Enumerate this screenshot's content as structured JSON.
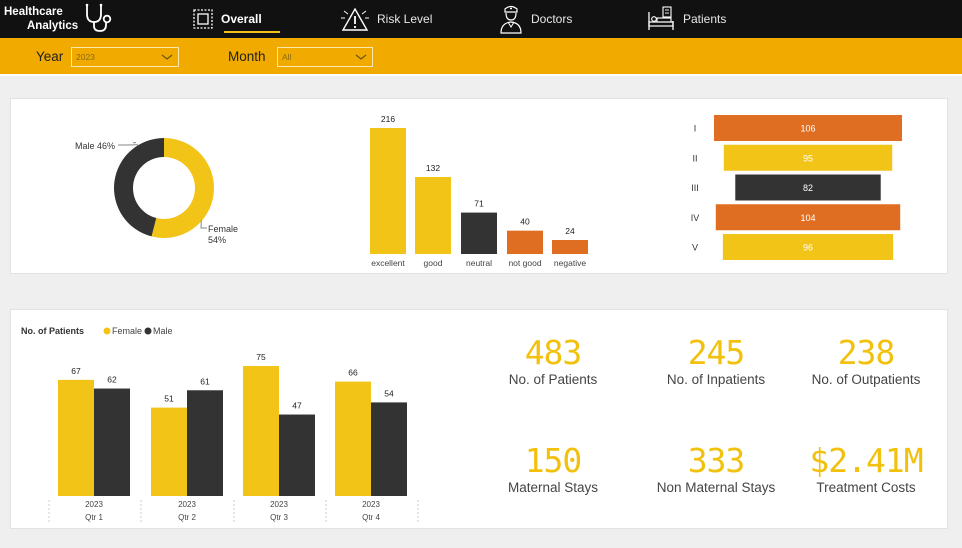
{
  "header": {
    "brand_line1": "Healthcare",
    "brand_line2": "Analytics",
    "nav": [
      {
        "label": "Overall",
        "icon": "dashboard-icon",
        "active": true
      },
      {
        "label": "Risk Level",
        "icon": "warning-icon",
        "active": false
      },
      {
        "label": "Doctors",
        "icon": "doctor-icon",
        "active": false
      },
      {
        "label": "Patients",
        "icon": "patient-bed-icon",
        "active": false
      }
    ]
  },
  "filters": {
    "year_label": "Year",
    "year_value": "2023",
    "month_label": "Month",
    "month_value": "All"
  },
  "colors": {
    "yellow": "#f2c418",
    "dark": "#333333",
    "orange": "#e06e22",
    "header": "#111111",
    "filterbar": "#f0aa00"
  },
  "chart_data": [
    {
      "type": "pie",
      "labels": [
        "Male",
        "Female"
      ],
      "values": [
        46,
        54
      ],
      "label_texts": [
        "Male 46%",
        "Female",
        "54%"
      ]
    },
    {
      "type": "bar",
      "categories": [
        "excellent",
        "good",
        "neutral",
        "not good",
        "negative"
      ],
      "values": [
        216,
        132,
        71,
        40,
        24
      ]
    },
    {
      "type": "bar",
      "orientation": "horizontal",
      "categories": [
        "I",
        "II",
        "III",
        "IV",
        "V"
      ],
      "values": [
        106,
        95,
        82,
        104,
        96
      ]
    },
    {
      "type": "bar",
      "title": "No. of Patients",
      "categories": [
        "Qtr 1",
        "Qtr 2",
        "Qtr 3",
        "Qtr 4"
      ],
      "category_year": "2023",
      "series": [
        {
          "name": "Female",
          "values": [
            67,
            51,
            75,
            66
          ]
        },
        {
          "name": "Male",
          "values": [
            62,
            61,
            47,
            54
          ]
        }
      ]
    }
  ],
  "kpis": [
    {
      "value": "483",
      "label": "No. of Patients"
    },
    {
      "value": "245",
      "label": "No. of Inpatients"
    },
    {
      "value": "238",
      "label": "No. of Outpatients"
    },
    {
      "value": "150",
      "label": "Maternal Stays"
    },
    {
      "value": "333",
      "label": "Non Maternal Stays"
    },
    {
      "value": "$2.41M",
      "label": "Treatment Costs"
    }
  ]
}
